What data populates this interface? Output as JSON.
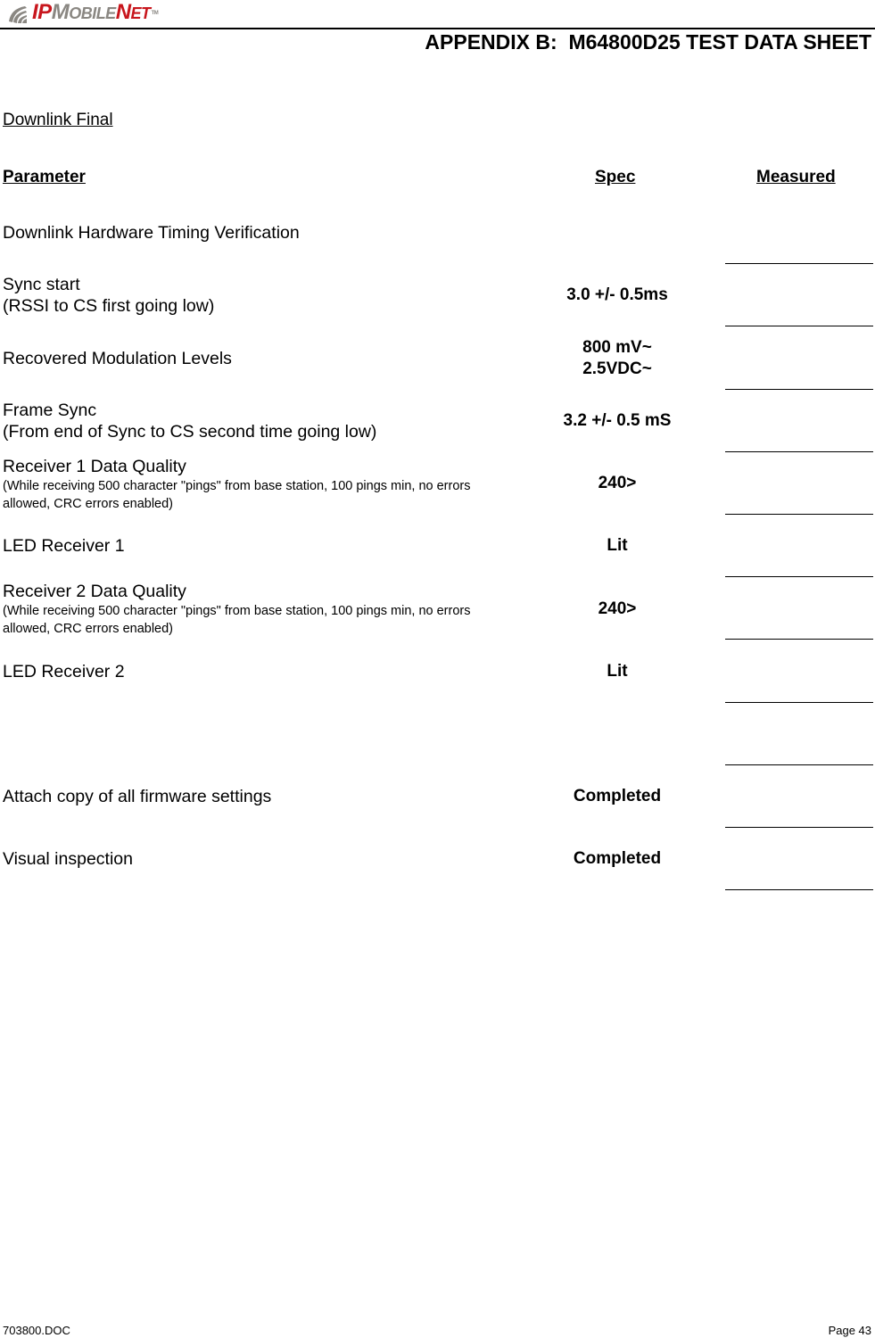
{
  "header": {
    "logo": {
      "icon": "ipmobilenet-swirl-logo-icon",
      "part_ip": "IP",
      "part_mobile_initial": "M",
      "part_mobile_rest": "OBILE",
      "part_net_initial": "N",
      "part_net_rest": "ET",
      "trademark": "TM",
      "colors": {
        "red": "#c8161d",
        "gray": "#8a8782"
      }
    },
    "title": "APPENDIX B:  M64800D25 TEST DATA SHEET"
  },
  "section_title": "Downlink Final",
  "columns": {
    "parameter": "Parameter",
    "spec": "Spec",
    "measured": "Measured"
  },
  "subheading": "Downlink Hardware Timing Verification",
  "rows": [
    {
      "parameter": "Sync start",
      "detail": "(RSSI to CS first going low)",
      "spec": "3.0 +/- 0.5ms",
      "measured": ""
    },
    {
      "parameter": "Recovered Modulation Levels",
      "spec": "800 mV~",
      "spec_line2": "2.5VDC~",
      "measured": ""
    },
    {
      "parameter": "Frame Sync",
      "detail": "(From end of Sync to CS second time going low)",
      "spec": "3.2 +/- 0.5 mS",
      "measured": ""
    },
    {
      "parameter": "Receiver 1  Data Quality",
      "note": "(While receiving 500 character \"pings\" from base station, 100 pings min, no errors allowed, CRC errors enabled)",
      "spec": "240>",
      "measured": ""
    },
    {
      "parameter": "LED Receiver 1",
      "spec": "Lit",
      "measured": ""
    },
    {
      "parameter": "Receiver 2 Data Quality",
      "note": "(While receiving 500 character \"pings\" from base station, 100 pings min, no errors allowed, CRC errors enabled)",
      "spec": "240>",
      "measured": ""
    },
    {
      "parameter": "LED Receiver 2",
      "spec": "Lit",
      "measured": ""
    },
    {
      "parameter": "",
      "spec": "",
      "measured": ""
    },
    {
      "parameter": "Attach copy of all firmware settings",
      "spec": "Completed",
      "measured": ""
    },
    {
      "parameter": "Visual inspection",
      "spec": "Completed",
      "measured": ""
    }
  ],
  "footer": {
    "doc_name": "703800.DOC",
    "page": "Page 43"
  }
}
